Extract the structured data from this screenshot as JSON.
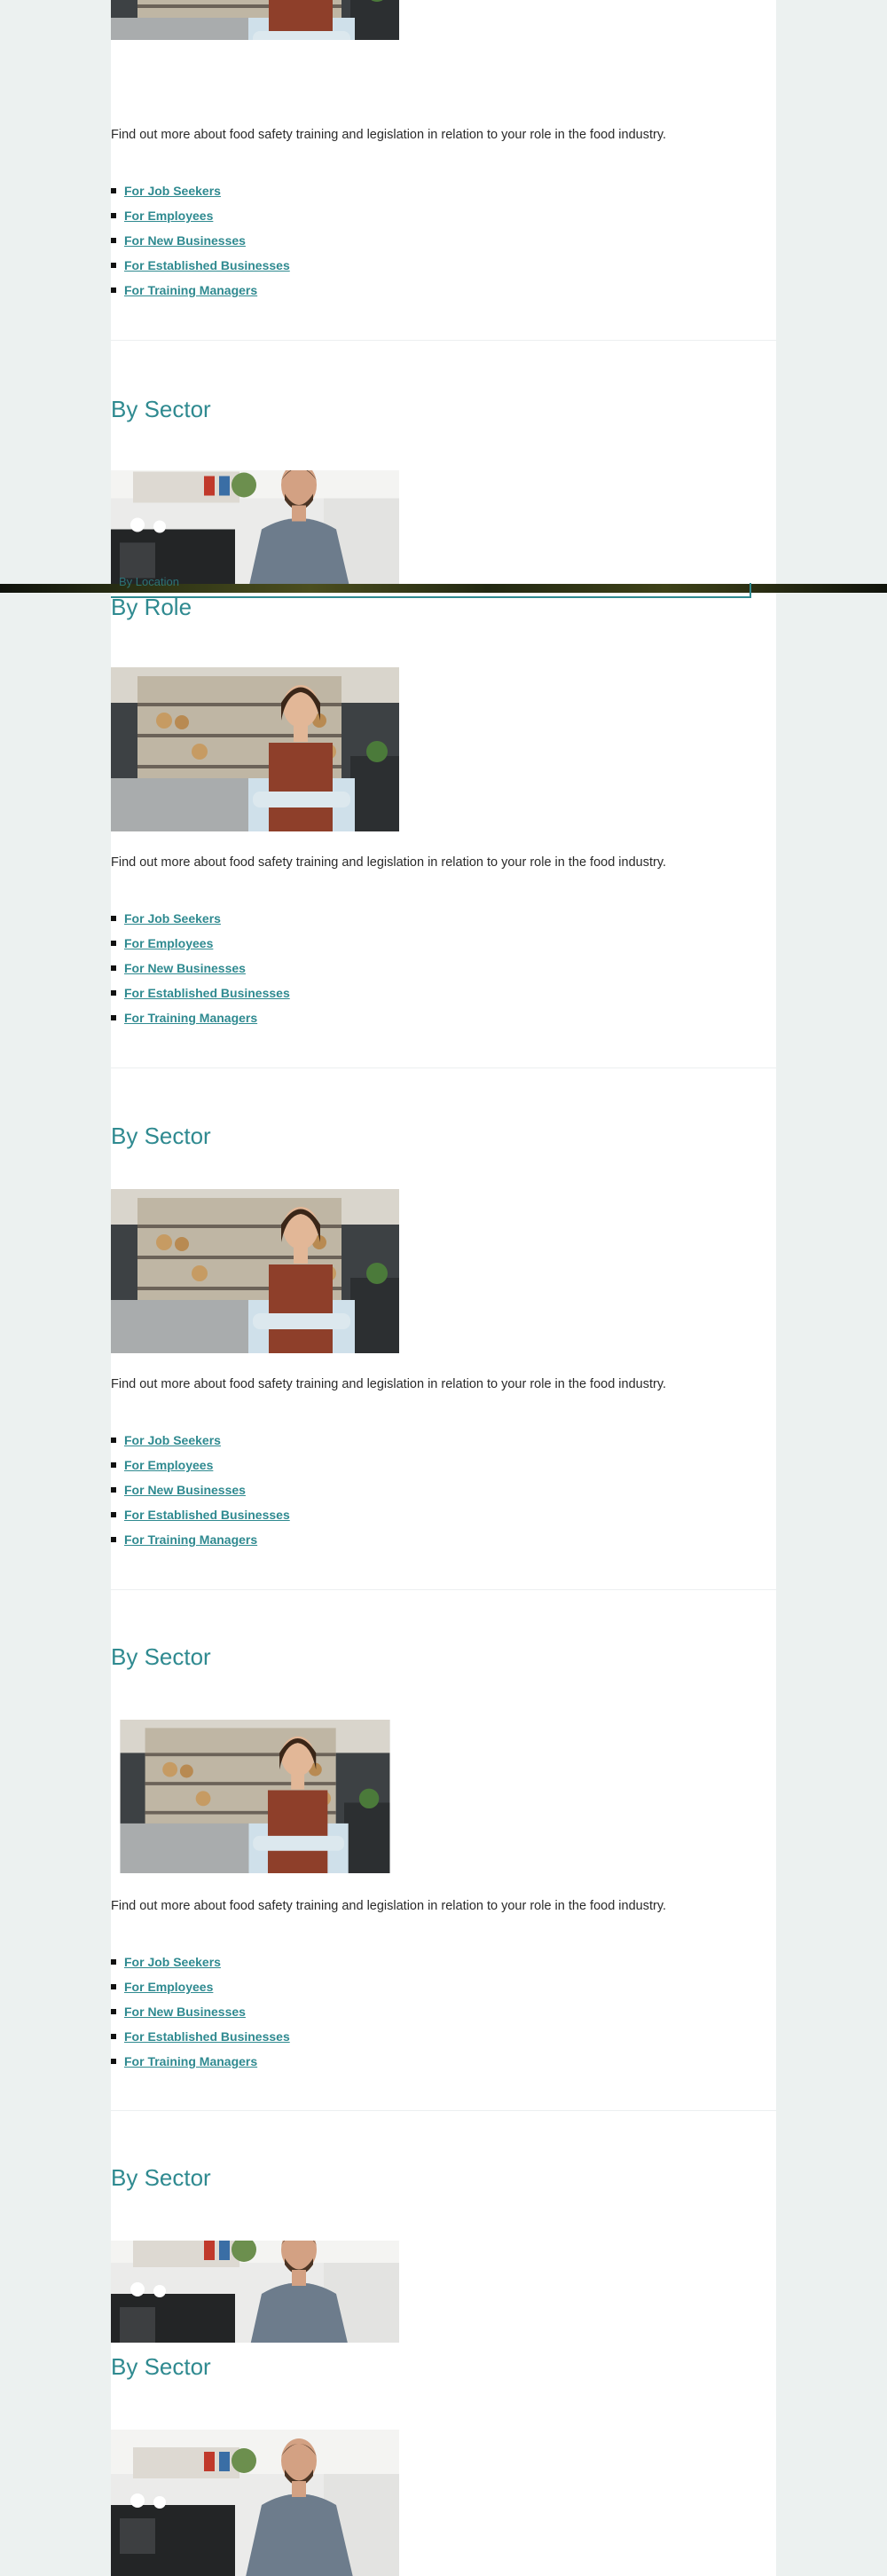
{
  "sections": {
    "intro_text": "Find out more about food safety training and legislation in relation to your role in the food industry.",
    "heading_sector": "By Sector",
    "heading_role": "By Role",
    "links": [
      "For Job Seekers",
      "For Employees",
      "For New Businesses",
      "For Established Businesses",
      "For Training Managers"
    ]
  },
  "overlay": {
    "partial_label": "By Location"
  },
  "images": {
    "woman": "woman-in-apron-bakery-photo",
    "man": "man-in-shirt-cafe-photo"
  },
  "colors": {
    "accent": "#2f8a90",
    "page_bg": "#ecf1f0",
    "content_bg": "#ffffff"
  }
}
